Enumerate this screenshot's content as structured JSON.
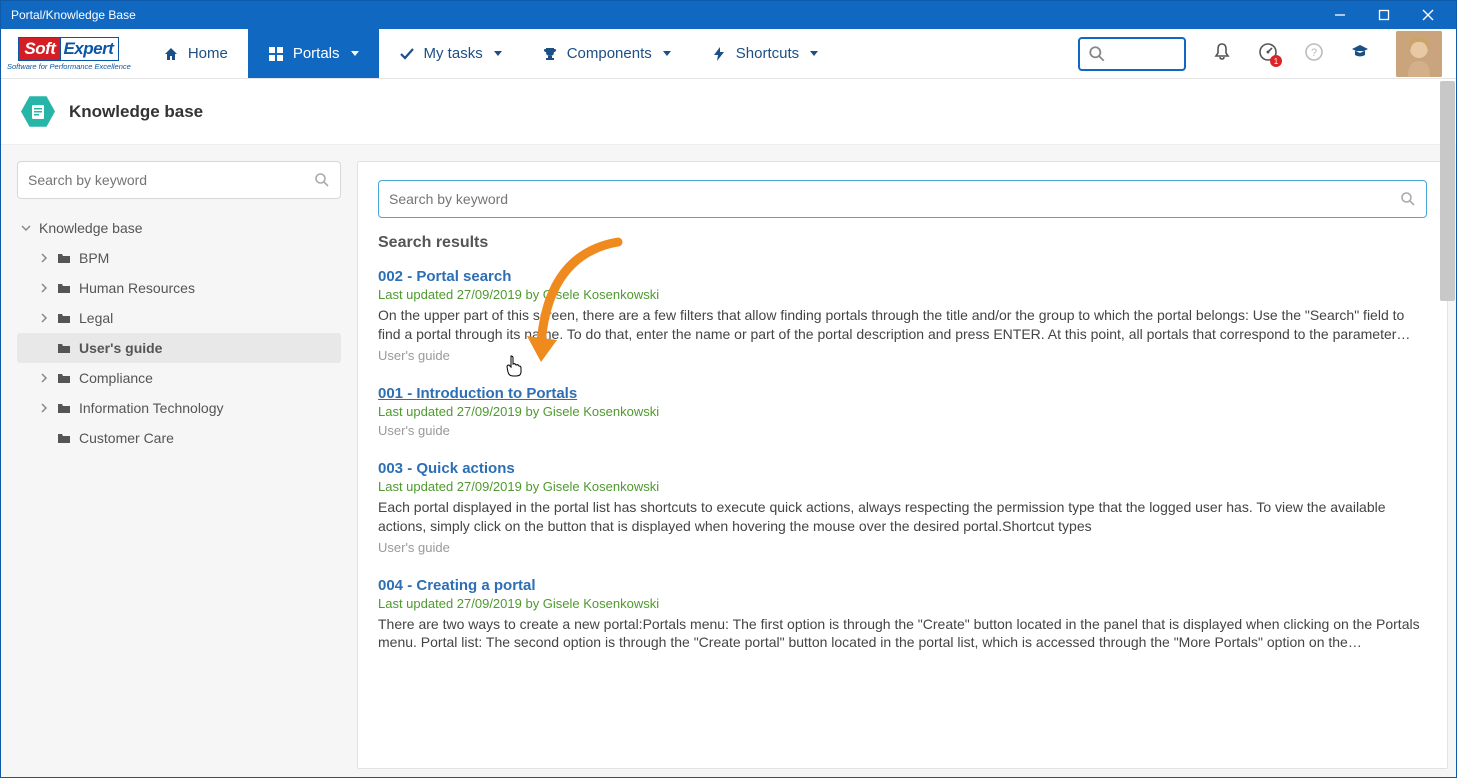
{
  "window": {
    "title": "Portal/Knowledge Base"
  },
  "logo": {
    "soft": "Soft",
    "expert": "Expert",
    "tagline": "Software for Performance Excellence"
  },
  "nav": {
    "home": "Home",
    "portals": "Portals",
    "mytasks": "My tasks",
    "components": "Components",
    "shortcuts": "Shortcuts"
  },
  "notifications": {
    "badge": "1"
  },
  "page": {
    "title": "Knowledge base"
  },
  "sidebar": {
    "search_placeholder": "Search by keyword",
    "root": "Knowledge base",
    "items": [
      {
        "label": "BPM"
      },
      {
        "label": "Human Resources"
      },
      {
        "label": "Legal"
      },
      {
        "label": "User's guide"
      },
      {
        "label": "Compliance"
      },
      {
        "label": "Information Technology"
      },
      {
        "label": "Customer Care"
      }
    ]
  },
  "main": {
    "search_placeholder": "Search by keyword",
    "results_heading": "Search results",
    "results": [
      {
        "title": "002 - Portal search",
        "meta": "Last updated 27/09/2019 by Gisele Kosenkowski",
        "body": "On the upper part of this screen, there are a few filters that allow finding portals through the title and/or the group to which the portal belongs: Use the \"Search\" field to find a portal through its name. To do that, enter the name or part of the portal description and press ENTER. At this point, all portals that correspond to the parameter…",
        "category": "User's guide"
      },
      {
        "title": "001 - Introduction to Portals",
        "meta": "Last updated 27/09/2019 by Gisele Kosenkowski",
        "body": "",
        "category": "User's guide"
      },
      {
        "title": "003 - Quick actions",
        "meta": "Last updated 27/09/2019 by Gisele Kosenkowski",
        "body": "Each portal displayed in the portal list has shortcuts to execute quick actions, always respecting the permission type that the logged user has. To view the available actions, simply click on the button that is displayed when hovering the mouse over the desired portal.Shortcut types",
        "category": "User's guide"
      },
      {
        "title": "004 - Creating a portal",
        "meta": "Last updated 27/09/2019 by Gisele Kosenkowski",
        "body": "There are two ways to create a new portal:Portals menu: The first option is through the \"Create\" button located in the panel that is displayed when clicking on the Portals menu. Portal list: The second option is through the \"Create portal\" button located in the portal list, which is accessed through the \"More Portals\" option on the…",
        "category": ""
      }
    ]
  }
}
